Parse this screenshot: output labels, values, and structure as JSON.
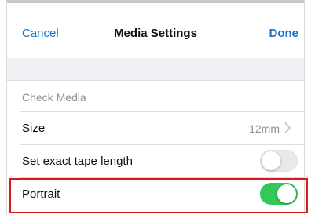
{
  "navbar": {
    "cancel_label": "Cancel",
    "title": "Media Settings",
    "done_label": "Done"
  },
  "section": {
    "header": "Check Media"
  },
  "rows": [
    {
      "label": "Size",
      "value": "12mm",
      "type": "disclosure"
    },
    {
      "label": "Set exact tape length",
      "type": "toggle",
      "on": false
    },
    {
      "label": "Portrait",
      "type": "toggle",
      "on": true
    }
  ],
  "colors": {
    "accent": "#1a73c9",
    "toggle_on": "#34c759",
    "toggle_off": "#e9e9eb",
    "highlight": "#d71920",
    "group_background": "#efeff4"
  },
  "icons": {
    "chevron": "chevron-right-icon"
  }
}
